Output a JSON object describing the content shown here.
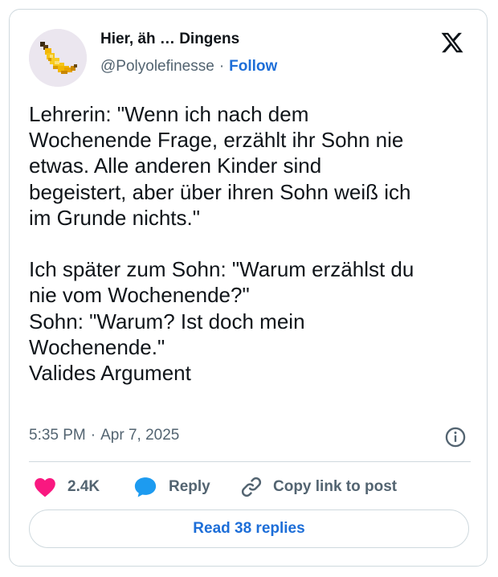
{
  "author": {
    "display_name": "Hier, äh … Dingens",
    "handle": "@Polyolefinesse",
    "separator": "·",
    "follow_label": "Follow"
  },
  "tweet": {
    "text": "Lehrerin: \"Wenn ich nach dem\nWochenende Frage, erzählt ihr Sohn nie\netwas. Alle anderen Kinder sind\nbegeistert, aber über ihren Sohn weiß ich\nim Grunde nichts.\"\n\nIch später zum Sohn: \"Warum erzählst du\nnie vom Wochenende?\"\nSohn: \"Warum? Ist doch mein\nWochenende.\"\nValides Argument",
    "time": "5:35 PM",
    "separator": "·",
    "date": "Apr 7, 2025"
  },
  "actions": {
    "like_count": "2.4K",
    "reply_label": "Reply",
    "copy_link_label": "Copy link to post"
  },
  "read_replies_label": "Read 38 replies",
  "icons": {
    "avatar": "pixel-banana-avatar",
    "brand": "x-logo-icon",
    "info": "info-icon",
    "like": "heart-icon",
    "reply": "speech-bubble-icon",
    "copy": "link-icon"
  },
  "colors": {
    "link_blue": "#1d6ed8",
    "heart_pink": "#f91880",
    "reply_blue": "#1d9bf0",
    "muted_gray": "#536471",
    "border": "#cfd9de"
  }
}
